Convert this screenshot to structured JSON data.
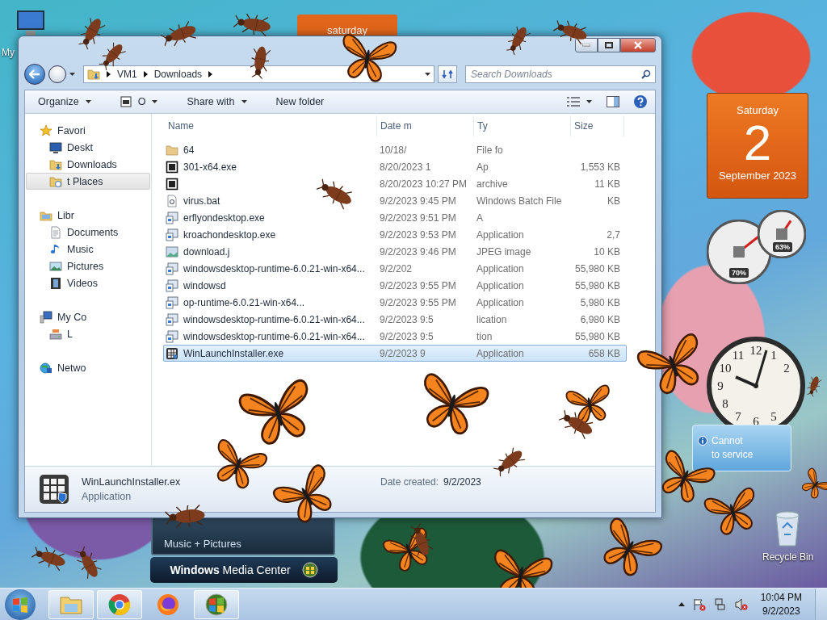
{
  "desktop": {
    "icon_labels": [
      "My"
    ],
    "calendar_top": {
      "weekday": "saturday"
    },
    "calendar": {
      "weekday": "Saturday",
      "day": "2",
      "month_year": "September 2023"
    },
    "meters": [
      {
        "reading": "70%",
        "level": 0.7
      },
      {
        "reading": "63%",
        "level": 0.63
      }
    ],
    "clock_numerals": [
      "11",
      "12",
      "1",
      "2",
      "10",
      "9",
      "8",
      "7",
      "6",
      "5"
    ],
    "weather": {
      "line_1": "Cannot",
      "line_2": "to service"
    },
    "media_center": {
      "strip": "Music + Pictures",
      "title": "**Windows** Media Center"
    },
    "recycle_bin": "Recycle Bin"
  },
  "explorer": {
    "address": [
      "VM1",
      "Downloads"
    ],
    "search": {
      "placeholder": "Search Downloads"
    },
    "commands": [
      {
        "label": "Organize",
        "menu": true
      },
      {
        "label": "O",
        "menu": true
      },
      {
        "label": "Share with",
        "menu": true
      },
      {
        "label": "New folder",
        "menu": false
      }
    ],
    "nav": [
      {
        "label": "Favori",
        "kind": "star",
        "selected": false,
        "children": [
          {
            "label": "Deskt",
            "kind": "desktop",
            "selected": false
          },
          {
            "label": "Downloads",
            "kind": "downloads",
            "selected": false
          },
          {
            "label": "t Places",
            "kind": "recent",
            "selected": true
          }
        ]
      },
      {
        "label": "Libr",
        "kind": "library",
        "selected": false,
        "children": [
          {
            "label": "Documents",
            "kind": "documents",
            "selected": false
          },
          {
            "label": "Music",
            "kind": "music",
            "selected": false
          },
          {
            "label": "Pictures",
            "kind": "pictures",
            "selected": false
          },
          {
            "label": "Videos",
            "kind": "videos",
            "selected": false
          }
        ]
      },
      {
        "label": "My Co",
        "kind": "computer",
        "selected": false,
        "children": [
          {
            "label": "L",
            "kind": "drive",
            "selected": false
          }
        ]
      },
      {
        "label": "Netwo",
        "kind": "network",
        "selected": false
      }
    ],
    "columns": [
      "Name",
      "Date m",
      "Ty",
      "Size"
    ],
    "rows": [
      {
        "name": "64",
        "date": "10/18/",
        "type": "File fo",
        "kind": "folder",
        "selected": false
      },
      {
        "name": "301-x64.exe",
        "date": "8/20/2023 1",
        "type": "Ap",
        "size": "1,553 KB",
        "kind": "archive",
        "selected": false
      },
      {
        "date": "8/20/2023 10:27 PM",
        "type": "archive",
        "size": "11 KB",
        "kind": "archive",
        "selected": false
      },
      {
        "name": "virus.bat",
        "date": "9/2/2023 9:45 PM",
        "type": "Windows Batch File",
        "size": "KB",
        "kind": "script",
        "selected": false
      },
      {
        "name": "erflyondesktop.exe",
        "date": "9/2/2023 9:51 PM",
        "type": "A",
        "kind": "program",
        "selected": false
      },
      {
        "name": "kroachondesktop.exe",
        "date": "9/2/2023 9:53 PM",
        "type": "Application",
        "size": "2,7",
        "kind": "program",
        "selected": false
      },
      {
        "name": "download.j",
        "date": "9/2/2023 9:46 PM",
        "type": "JPEG image",
        "size": "10 KB",
        "kind": "image",
        "selected": false
      },
      {
        "name": "windowsdesktop-runtime-6.0.21-win-x64...",
        "date": "9/2/202",
        "type": "Application",
        "size": "55,980 KB",
        "kind": "program",
        "selected": false
      },
      {
        "name": "windowsd",
        "date": "9/2/2023 9:55 PM",
        "type": "Application",
        "size": "55,980 KB",
        "kind": "program",
        "selected": false
      },
      {
        "name": "op-runtime-6.0.21-win-x64...",
        "date": "9/2/2023 9:55 PM",
        "type": "Application",
        "size": "5,980 KB",
        "kind": "program",
        "selected": false
      },
      {
        "name": "windowsdesktop-runtime-6.0.21-win-x64...",
        "date": "9/2/2023 9:5",
        "type": "lication",
        "size": "6,980 KB",
        "kind": "program",
        "selected": false
      },
      {
        "name": "windowsdesktop-runtime-6.0.21-win-x64...",
        "date": "9/2/2023 9:5",
        "type": "tion",
        "size": "55,980 KB",
        "kind": "program",
        "selected": false
      },
      {
        "name": "WinLaunchInstaller.exe",
        "date": "9/2/2023 9",
        "type": "Application",
        "size": "658 KB",
        "kind": "installer",
        "selected": true
      }
    ],
    "details": {
      "name": "WinLaunchInstaller.ex",
      "type": "Application",
      "created_label": "Date created:",
      "created": "9/2/2023"
    }
  },
  "taskbar": {
    "time": "10:04 PM",
    "date": "9/2/2023"
  }
}
